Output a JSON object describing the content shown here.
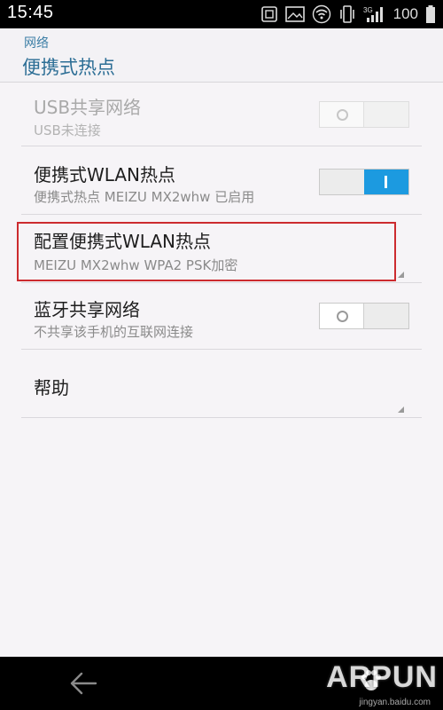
{
  "status_bar": {
    "time": "15:45",
    "battery": "100",
    "icons": [
      "screenshot-icon",
      "image-icon",
      "wifi-icon",
      "vibrate-icon",
      "signal-3g-icon",
      "battery-icon"
    ]
  },
  "header": {
    "breadcrumb": "网络",
    "title": "便携式热点"
  },
  "settings": [
    {
      "title": "USB共享网络",
      "subtitle": "USB未连接",
      "toggle": "off",
      "enabled": false
    },
    {
      "title": "便携式WLAN热点",
      "subtitle": "便携式热点 MEIZU MX2whw 已启用",
      "toggle": "on",
      "enabled": true
    },
    {
      "title": "配置便携式WLAN热点",
      "subtitle": "MEIZU MX2whw WPA2 PSK加密",
      "highlighted": true
    },
    {
      "title": "蓝牙共享网络",
      "subtitle": "不共享该手机的互联网连接",
      "toggle": "off",
      "enabled": true
    },
    {
      "title": "帮助"
    }
  ],
  "navbar": {
    "back_icon": "back-arrow-icon"
  },
  "watermark": {
    "text": "ARPUN",
    "url": "jingyan.baidu.com"
  },
  "colors": {
    "accent": "#1c9ae0",
    "header_text": "#2c6e95",
    "highlight_border": "#cc2b2f"
  }
}
